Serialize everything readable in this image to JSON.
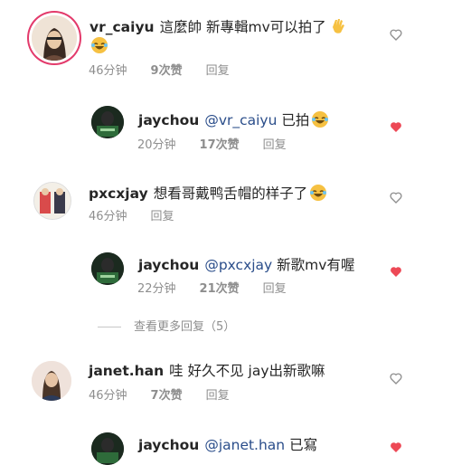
{
  "comments": [
    {
      "username": "vr_caiyu",
      "text": "這麼帥 新專輯mv可以拍了",
      "time": "46分钟",
      "likes": "9次赞",
      "reply": "回复",
      "liked": false,
      "emoji": "wave"
    },
    {
      "username": "jaychou",
      "mention": "@vr_caiyu",
      "text": "已拍",
      "time": "20分钟",
      "likes": "17次赞",
      "reply": "回复",
      "liked": true,
      "emoji": "laugh"
    },
    {
      "username": "pxcxjay",
      "text": "想看哥戴鸭舌帽的样子了",
      "time": "46分钟",
      "likes": "",
      "reply": "回复",
      "liked": false,
      "emoji": "laugh"
    },
    {
      "username": "jaychou",
      "mention": "@pxcxjay",
      "text": "新歌mv有喔",
      "time": "22分钟",
      "likes": "21次赞",
      "reply": "回复",
      "liked": true
    },
    {
      "username": "janet.han",
      "text": "哇 好久不见 jay出新歌嘛",
      "time": "46分钟",
      "likes": "7次赞",
      "reply": "回复",
      "liked": false
    },
    {
      "username": "jaychou",
      "mention": "@janet.han",
      "text": "已寫",
      "liked": true
    }
  ],
  "view_more": "查看更多回复（5）",
  "colors": {
    "heart_liked": "#ed4956",
    "heart_outline": "#8e8e8e",
    "mention": "#2a4d8a"
  }
}
